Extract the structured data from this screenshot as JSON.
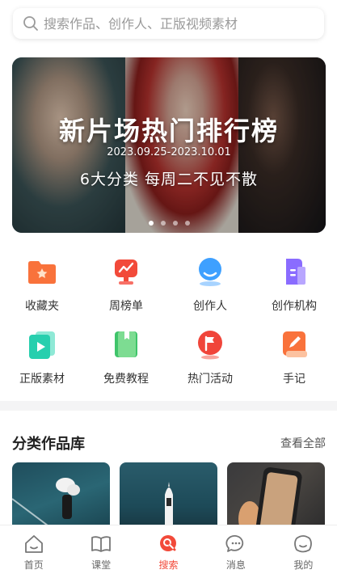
{
  "search": {
    "placeholder": "搜索作品、创作人、正版视频素材"
  },
  "banner": {
    "title": "新片场热门排行榜",
    "date": "2023.09.25-2023.10.01",
    "tagline": "6大分类 每周二不见不散",
    "dots": 4,
    "active_dot": 0
  },
  "shortcuts": [
    {
      "label": "收藏夹",
      "icon": "folder-star-icon",
      "color": "#f9723b"
    },
    {
      "label": "周榜单",
      "icon": "trophy-icon",
      "color": "#f24a3a"
    },
    {
      "label": "创作人",
      "icon": "user-icon",
      "color": "#3ea0ff"
    },
    {
      "label": "创作机构",
      "icon": "building-icon",
      "color": "#8a6cff"
    },
    {
      "label": "正版素材",
      "icon": "play-card-icon",
      "color": "#27cfae"
    },
    {
      "label": "免费教程",
      "icon": "book-icon",
      "color": "#3fc46a"
    },
    {
      "label": "热门活动",
      "icon": "flag-icon",
      "color": "#f0453a"
    },
    {
      "label": "手记",
      "icon": "note-icon",
      "color": "#f9723b"
    }
  ],
  "section": {
    "title": "分类作品库",
    "see_all": "查看全部"
  },
  "tabs": [
    {
      "label": "首页",
      "icon": "home-icon"
    },
    {
      "label": "课堂",
      "icon": "book-open-icon"
    },
    {
      "label": "搜索",
      "icon": "search-tab-icon",
      "active": true
    },
    {
      "label": "消息",
      "icon": "message-icon"
    },
    {
      "label": "我的",
      "icon": "profile-icon"
    }
  ],
  "colors": {
    "accent": "#f24a3a"
  }
}
